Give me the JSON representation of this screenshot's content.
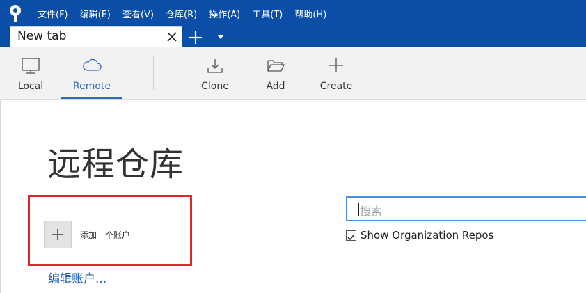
{
  "menu": {
    "items": [
      "文件(F)",
      "编辑(E)",
      "查看(V)",
      "仓库(R)",
      "操作(A)",
      "工具(T)",
      "帮助(H)"
    ]
  },
  "tab": {
    "title": "New tab"
  },
  "toolbar": {
    "local": "Local",
    "remote": "Remote",
    "clone": "Clone",
    "add": "Add",
    "create": "Create"
  },
  "main": {
    "title": "远程仓库",
    "add_account_label": "添加一个账户",
    "edit_accounts_link": "编辑账户...",
    "search_placeholder": "搜索",
    "show_org_repos_label": "Show Organization Repos",
    "show_org_repos_checked": true
  },
  "colors": {
    "titlebar": "#0b4ea8",
    "accent": "#2d6ab8",
    "highlight_border": "#e0262a"
  }
}
